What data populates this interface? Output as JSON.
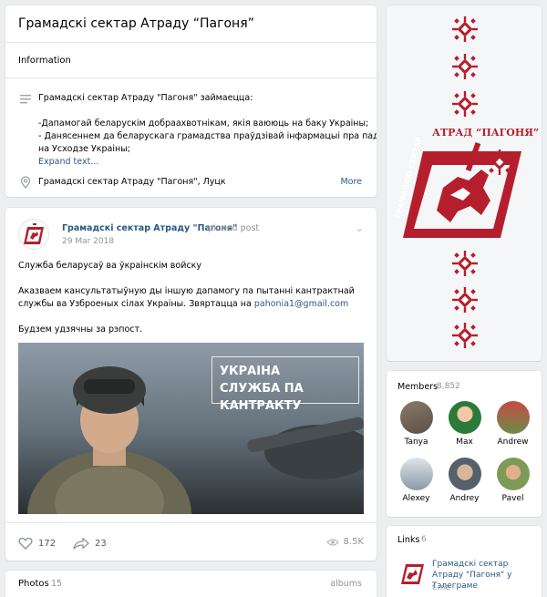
{
  "group": {
    "title": "Грамадскі сектар Атраду “Пагоня”"
  },
  "info": {
    "section_label": "Information",
    "description": [
      "Грамадскі сектар Атраду \"Пагоня\" займаецца:",
      "",
      "-Дапамогай беларускім добраахвотнікам, якія ваююць на баку Украіны;",
      "- Данясеннем да беларускага грамадства праўдзівай інфармацыі пра падзеі",
      "на Усходзе Украіны;"
    ],
    "expand_label": "Expand text...",
    "location": "Грамадскі сектар Атраду \"Пагоня\", Луцк",
    "more_label": "More"
  },
  "post": {
    "author": "Грамадскі сектар Атраду \"Пагоня\"",
    "pinned_label": "pinned post",
    "date": "29 Mar 2018",
    "text_1": "Служба беларусаў ва ўкраінскім войску",
    "text_2": "Аказваем кансультатыўную ды іншую дапамогу па пытанні кантрактнай службы ва Узброеных сілах Украіны. Звяртацца на",
    "email": "pahonia1@gmail.com",
    "text_3": "Будзем удзячны за рэпост.",
    "image_banner_line1": "УКРАІНА",
    "image_banner_line2": "СЛУЖБА ПА КАНТРАКТУ",
    "likes": "172",
    "shares": "23",
    "views": "8.5K"
  },
  "photos": {
    "label": "Photos",
    "count": "15",
    "albums_label": "albums"
  },
  "cover": {
    "title_line1": "АТРАД “ПАГОНЯ”",
    "title_line2": "ГРАМАДСКІ СЕКТАР"
  },
  "members": {
    "label": "Members",
    "count": "8,852",
    "people": [
      {
        "name": "Tanya"
      },
      {
        "name": "Max"
      },
      {
        "name": "Andrew"
      },
      {
        "name": "Alexey"
      },
      {
        "name": "Andrey"
      },
      {
        "name": "Pavel"
      }
    ]
  },
  "links": {
    "label": "Links",
    "count": "6",
    "items": [
      {
        "title": "Грамадскі сектар Атраду \"Пагоня\" у Тэлеграме",
        "domain": "t.me"
      }
    ]
  },
  "colors": {
    "accent": "#2a5885",
    "brand_red": "#b51f2d",
    "muted": "#939393"
  }
}
